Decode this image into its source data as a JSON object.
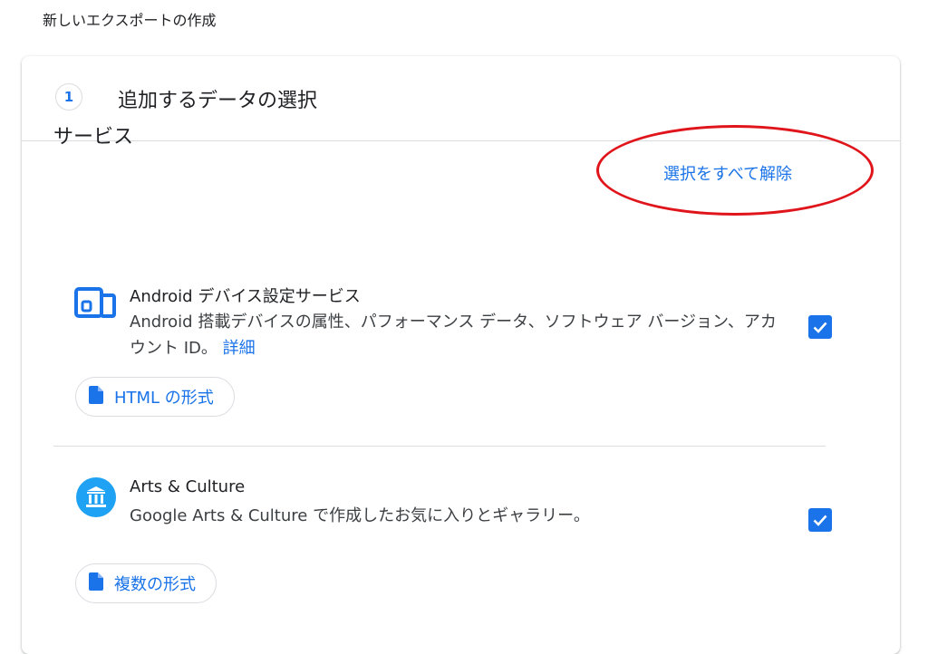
{
  "page": {
    "title": "新しいエクスポートの作成"
  },
  "step": {
    "number": "1",
    "title": "追加するデータの選択"
  },
  "services_section": {
    "title": "サービス",
    "deselect_all_label": "選択をすべて解除",
    "annotation_color": "#e0151b"
  },
  "services": [
    {
      "icon": "android-device-icon",
      "name": "Android デバイス設定サービス",
      "description": "Android 搭載デバイスの属性、パフォーマンス データ、ソフトウェア バージョン、アカウント ID。",
      "detail_link": "詳細",
      "checked": true,
      "format_label": "HTML の形式"
    },
    {
      "icon": "arts-culture-icon",
      "name": "Arts & Culture",
      "description": "Google Arts & Culture で作成したお気に入りとギャラリー。",
      "checked": true,
      "format_label": "複数の形式"
    }
  ],
  "colors": {
    "accent": "#1a73e8",
    "divider": "#dadce0",
    "text": "#202124"
  }
}
